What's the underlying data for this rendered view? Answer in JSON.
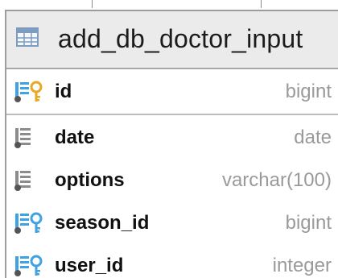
{
  "table": {
    "name": "add_db_doctor_input",
    "icon": "table-icon"
  },
  "columns": [
    {
      "name": "id",
      "type": "bigint",
      "icon": "primary-key-column-icon"
    },
    {
      "name": "date",
      "type": "date",
      "icon": "column-icon"
    },
    {
      "name": "options",
      "type": "varchar(100)",
      "icon": "column-icon"
    },
    {
      "name": "season_id",
      "type": "bigint",
      "icon": "foreign-key-column-icon"
    },
    {
      "name": "user_id",
      "type": "integer",
      "icon": "foreign-key-column-icon"
    }
  ],
  "colors": {
    "header_bg": "#ebebeb",
    "type_text": "#9a9a9a",
    "key_gold": "#e7a823",
    "key_blue": "#3fa2e3",
    "column_grey": "#8c8c8c"
  }
}
